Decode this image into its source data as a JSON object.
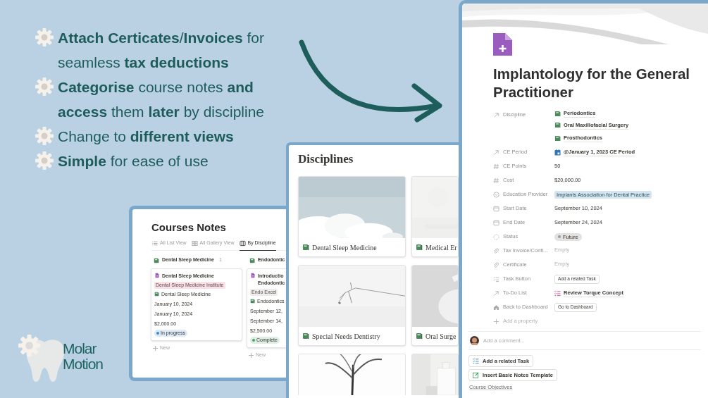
{
  "bullets": [
    {
      "text": "**Attach Certicates**/**Invoices** for seamless **tax deductions**"
    },
    {
      "text": "**Categorise** course notes **and access** them **later** by discipline"
    },
    {
      "text": "Change to **different views**"
    },
    {
      "text": "**Simple** for ease of use"
    }
  ],
  "logo": {
    "text": "Molar Motion"
  },
  "courses_notes": {
    "title": "Courses Notes",
    "tabs": [
      {
        "label": "All List View",
        "kind": "list",
        "selected": false
      },
      {
        "label": "All Gallery View",
        "kind": "gallery",
        "selected": false
      },
      {
        "label": "By Discipline",
        "kind": "board",
        "selected": true
      }
    ],
    "groups": [
      {
        "name": "Dental Sleep Medicine",
        "count": "1",
        "new_label": "New",
        "cards": [
          {
            "title": "Dental Sleep Medicine",
            "provider": {
              "text": "Dental Sleep Medicine Institute",
              "color": "#f9dfe6"
            },
            "discipline": "Dental Sleep Medicine",
            "start": "January 10, 2024",
            "end": "January 10, 2024",
            "cost": "$2,000.00",
            "status": {
              "text": "In progress",
              "color": "#3b8bd4"
            }
          }
        ]
      },
      {
        "name": "Endodontic",
        "new_label": "New",
        "cards": [
          {
            "title": "Introductio Endodontic",
            "provider": {
              "text": "Endo Excel",
              "color": "#ededeb"
            },
            "discipline": "Endodontics",
            "start": "September 12,",
            "end": "September 14,",
            "cost": "$2,500.00",
            "status": {
              "text": "Complete",
              "color": "#4ea36c"
            }
          }
        ]
      }
    ]
  },
  "disciplines": {
    "title": "Disciplines",
    "cards": [
      {
        "title": "Dental Sleep Medicine"
      },
      {
        "title": "Medical Er"
      },
      {
        "title": "Special Needs Dentistry"
      },
      {
        "title": "Oral Surge"
      },
      {
        "kind": "picture"
      },
      {
        "kind": "picture"
      }
    ]
  },
  "page": {
    "title": "Implantology for the General Practitioner",
    "properties": [
      {
        "label": "Discipline",
        "kind": "relation",
        "values": [
          {
            "text": "Periodontics",
            "kind": "page"
          },
          {
            "text": "Oral Maxillofacial Surgery",
            "kind": "page"
          },
          {
            "text": "Prosthodontics",
            "kind": "page"
          }
        ]
      },
      {
        "label": "CE Period",
        "kind": "relation",
        "values": [
          {
            "text": "@January 1, 2023 CE Period",
            "kind": "calendar"
          }
        ]
      },
      {
        "label": "CE Points",
        "kind": "number",
        "value": "50"
      },
      {
        "label": "Cost",
        "kind": "number",
        "value": "$20,000.00"
      },
      {
        "label": "Education Provider",
        "kind": "select",
        "value": "Implants Association for Dental Practice",
        "color": "#d3e5ef"
      },
      {
        "label": "Start Date",
        "kind": "date",
        "value": "September 10, 2024"
      },
      {
        "label": "End Date",
        "kind": "date",
        "value": "September 24, 2024"
      },
      {
        "label": "Status",
        "kind": "status",
        "value": "Future",
        "color": "#9b9a97"
      },
      {
        "label": "Tax Invoice/Confi...",
        "kind": "files",
        "value": "Empty"
      },
      {
        "label": "Certificate",
        "kind": "files",
        "value": "Empty"
      },
      {
        "label": "Task Button",
        "kind": "button",
        "value": "Add a related Task"
      },
      {
        "label": "To-Do List",
        "kind": "relation",
        "values": [
          {
            "text": "Review Torque Concept",
            "kind": "task"
          }
        ]
      },
      {
        "label": "Back to Dashboard",
        "kind": "home_button",
        "value": "Go to Dashboard"
      }
    ],
    "add_property": "Add a property",
    "comment_placeholder": "Add a comment...",
    "actions": [
      {
        "label": "Add a related Task",
        "kind": "task"
      },
      {
        "label": "Insert Basic Notes Template",
        "kind": "template"
      }
    ],
    "section_heading": "Course Objectives"
  }
}
